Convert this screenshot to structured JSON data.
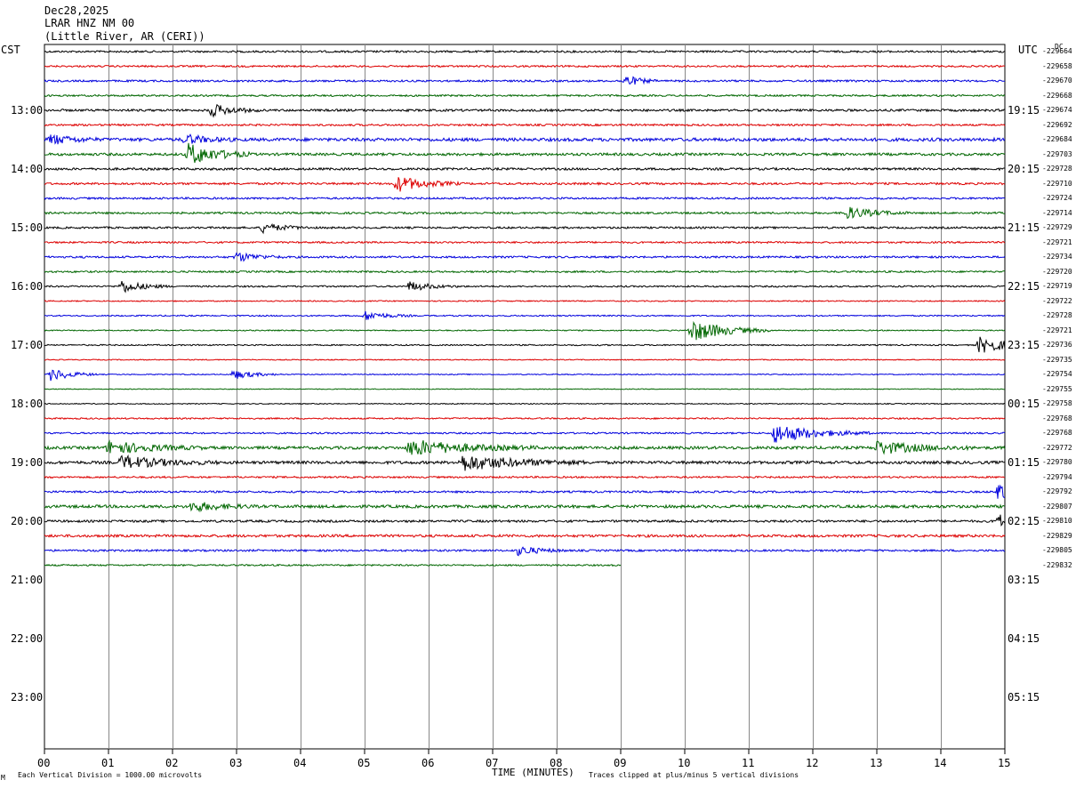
{
  "header": {
    "date": "Dec28,2025",
    "station": "LRAR HNZ NM 00",
    "location": "(Little River, AR (CERI))"
  },
  "left_axis_label": "CST",
  "right_axis_label": "UTC",
  "dc_label": "DC",
  "footer": {
    "scale_note": "Each Vertical Division = 1000.00 microvolts",
    "clip_note": "Traces clipped at plus/minus 5 vertical divisions",
    "corner_mark": "M"
  },
  "colors": {
    "black": "#000000",
    "red": "#dd0000",
    "blue": "#0000dd",
    "green": "#006600",
    "grid": "#888888"
  },
  "chart_data": {
    "type": "line",
    "xlabel": "TIME (MINUTES)",
    "xlim": [
      0,
      15
    ],
    "x_ticks": [
      "00",
      "01",
      "02",
      "03",
      "04",
      "05",
      "06",
      "07",
      "08",
      "09",
      "10",
      "11",
      "12",
      "13",
      "14",
      "15"
    ],
    "hour_labels_cst": [
      "13:00",
      "14:00",
      "15:00",
      "16:00",
      "17:00",
      "18:00",
      "19:00",
      "20:00",
      "21:00",
      "22:00",
      "23:00"
    ],
    "hour_labels_utc": [
      "19:15",
      "20:15",
      "21:15",
      "22:15",
      "23:15",
      "00:15",
      "01:15",
      "02:15",
      "03:15",
      "04:15",
      "05:15"
    ],
    "trace_color_cycle": [
      "black",
      "red",
      "blue",
      "green"
    ],
    "last_trace_end_minute": 9.0,
    "dc_offsets": [
      "-229664",
      "-229658",
      "-229670",
      "-229668",
      "-229674",
      "-229692",
      "-229684",
      "-229703",
      "-229728",
      "-229710",
      "-229724",
      "-229714",
      "-229729",
      "-229721",
      "-229734",
      "-229720",
      "-229719",
      "-229722",
      "-229728",
      "-229721",
      "-229736",
      "-229735",
      "-229754",
      "-229755",
      "-229758",
      "-229768",
      "-229768",
      "-229772",
      "-229780",
      "-229794",
      "-229792",
      "-229807",
      "-229810",
      "-229829",
      "-229805",
      "-229832"
    ],
    "trace_amplitude": [
      0.6,
      0.55,
      0.6,
      0.55,
      0.7,
      0.6,
      1.0,
      0.8,
      0.7,
      0.65,
      0.6,
      0.6,
      0.6,
      0.55,
      0.6,
      0.55,
      0.5,
      0.35,
      0.4,
      0.35,
      0.4,
      0.3,
      0.3,
      0.25,
      0.3,
      0.45,
      0.5,
      0.9,
      0.9,
      0.55,
      0.6,
      0.9,
      0.7,
      0.8,
      0.6,
      0.5
    ],
    "events": [
      {
        "trace": 2,
        "minute": 9.05,
        "amp": 4,
        "dur": 0.2
      },
      {
        "trace": 4,
        "minute": 2.6,
        "amp": 4,
        "dur": 0.3
      },
      {
        "trace": 6,
        "minute": 0.1,
        "amp": 3,
        "dur": 0.3
      },
      {
        "trace": 6,
        "minute": 2.2,
        "amp": 3,
        "dur": 0.3
      },
      {
        "trace": 7,
        "minute": 2.25,
        "amp": 7,
        "dur": 0.4
      },
      {
        "trace": 9,
        "minute": 5.5,
        "amp": 5,
        "dur": 0.4
      },
      {
        "trace": 11,
        "minute": 12.5,
        "amp": 4,
        "dur": 0.4
      },
      {
        "trace": 12,
        "minute": 3.4,
        "amp": 3,
        "dur": 0.3
      },
      {
        "trace": 14,
        "minute": 3.0,
        "amp": 3,
        "dur": 0.3
      },
      {
        "trace": 16,
        "minute": 1.2,
        "amp": 4,
        "dur": 0.3
      },
      {
        "trace": 16,
        "minute": 5.7,
        "amp": 3,
        "dur": 0.3
      },
      {
        "trace": 18,
        "minute": 5.0,
        "amp": 3,
        "dur": 0.3
      },
      {
        "trace": 19,
        "minute": 10.1,
        "amp": 7,
        "dur": 0.5
      },
      {
        "trace": 20,
        "minute": 14.6,
        "amp": 5,
        "dur": 0.5
      },
      {
        "trace": 22,
        "minute": 0.1,
        "amp": 4,
        "dur": 0.3
      },
      {
        "trace": 22,
        "minute": 2.95,
        "amp": 3,
        "dur": 0.3
      },
      {
        "trace": 26,
        "minute": 11.4,
        "amp": 6,
        "dur": 0.6
      },
      {
        "trace": 27,
        "minute": 1.0,
        "amp": 4,
        "dur": 0.6
      },
      {
        "trace": 27,
        "minute": 5.7,
        "amp": 5,
        "dur": 0.8
      },
      {
        "trace": 27,
        "minute": 13.0,
        "amp": 4,
        "dur": 0.6
      },
      {
        "trace": 28,
        "minute": 1.2,
        "amp": 4,
        "dur": 0.6
      },
      {
        "trace": 28,
        "minute": 6.5,
        "amp": 5,
        "dur": 0.8
      },
      {
        "trace": 30,
        "minute": 14.9,
        "amp": 5,
        "dur": 0.3
      },
      {
        "trace": 31,
        "minute": 2.3,
        "amp": 3,
        "dur": 0.4
      },
      {
        "trace": 32,
        "minute": 14.9,
        "amp": 4,
        "dur": 0.3
      },
      {
        "trace": 34,
        "minute": 7.4,
        "amp": 3,
        "dur": 0.3
      }
    ]
  }
}
